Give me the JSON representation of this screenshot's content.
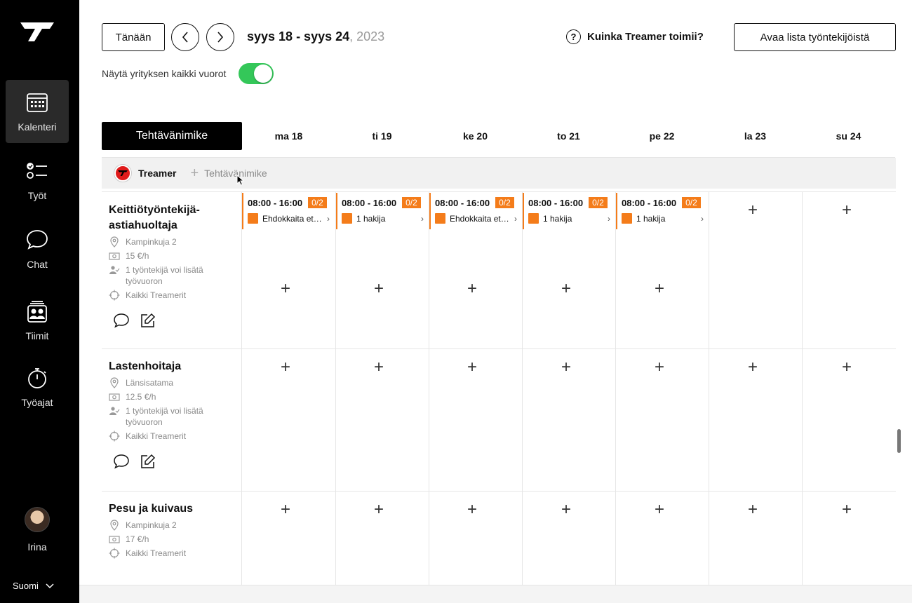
{
  "sidebar": {
    "items": [
      {
        "label": "Kalenteri",
        "icon": "calendar-icon",
        "active": true
      },
      {
        "label": "Työt",
        "icon": "checklist-icon"
      },
      {
        "label": "Chat",
        "icon": "chat-icon"
      },
      {
        "label": "Tiimit",
        "icon": "team-icon"
      },
      {
        "label": "Työajat",
        "icon": "stopwatch-icon"
      }
    ],
    "user_name": "Irina",
    "language": "Suomi"
  },
  "header": {
    "today_label": "Tänään",
    "date_range": "syys 18 - syys 24",
    "year": ", 2023",
    "help_label": "Kuinka Treamer toimii?",
    "open_list_label": "Avaa lista työntekijöistä",
    "toggle_label": "Näytä yrityksen kaikki vuorot",
    "toggle_on": true
  },
  "grid": {
    "first_column_label": "Tehtävänimike",
    "days": [
      "ma 18",
      "ti 19",
      "ke 20",
      "to 21",
      "pe 22",
      "la 23",
      "su 24"
    ],
    "company_name": "Treamer",
    "add_job_label": "Tehtävänimike"
  },
  "jobs": [
    {
      "title": "Keittiötyöntekijä-astiahuoltaja",
      "location": "Kampinkuja 2",
      "wage": "15 €/h",
      "workers": "1 työntekijä voi lisätä työvuoron",
      "visibility": "Kaikki Treamerit"
    },
    {
      "title": "Lastenhoitaja",
      "location": "Länsisatama",
      "wage": "12.5 €/h",
      "workers": "1 työntekijä voi lisätä työvuoron",
      "visibility": "Kaikki Treamerit"
    },
    {
      "title": "Pesu ja kuivaus",
      "location": "Kampinkuja 2",
      "wage": "17 €/h",
      "visibility": "Kaikki Treamerit"
    }
  ],
  "shifts": [
    {
      "time": "08:00 - 16:00",
      "badge": "0/2",
      "applicant": "Ehdokkaita et…"
    },
    {
      "time": "08:00 - 16:00",
      "badge": "0/2",
      "applicant": "1 hakija"
    },
    {
      "time": "08:00 - 16:00",
      "badge": "0/2",
      "applicant": "Ehdokkaita et…"
    },
    {
      "time": "08:00 - 16:00",
      "badge": "0/2",
      "applicant": "1 hakija"
    },
    {
      "time": "08:00 - 16:00",
      "badge": "0/2",
      "applicant": "1 hakija"
    }
  ],
  "colors": {
    "accent_orange": "#f47c1a",
    "toggle_green": "#34c759",
    "sidebar_bg": "#000000"
  }
}
